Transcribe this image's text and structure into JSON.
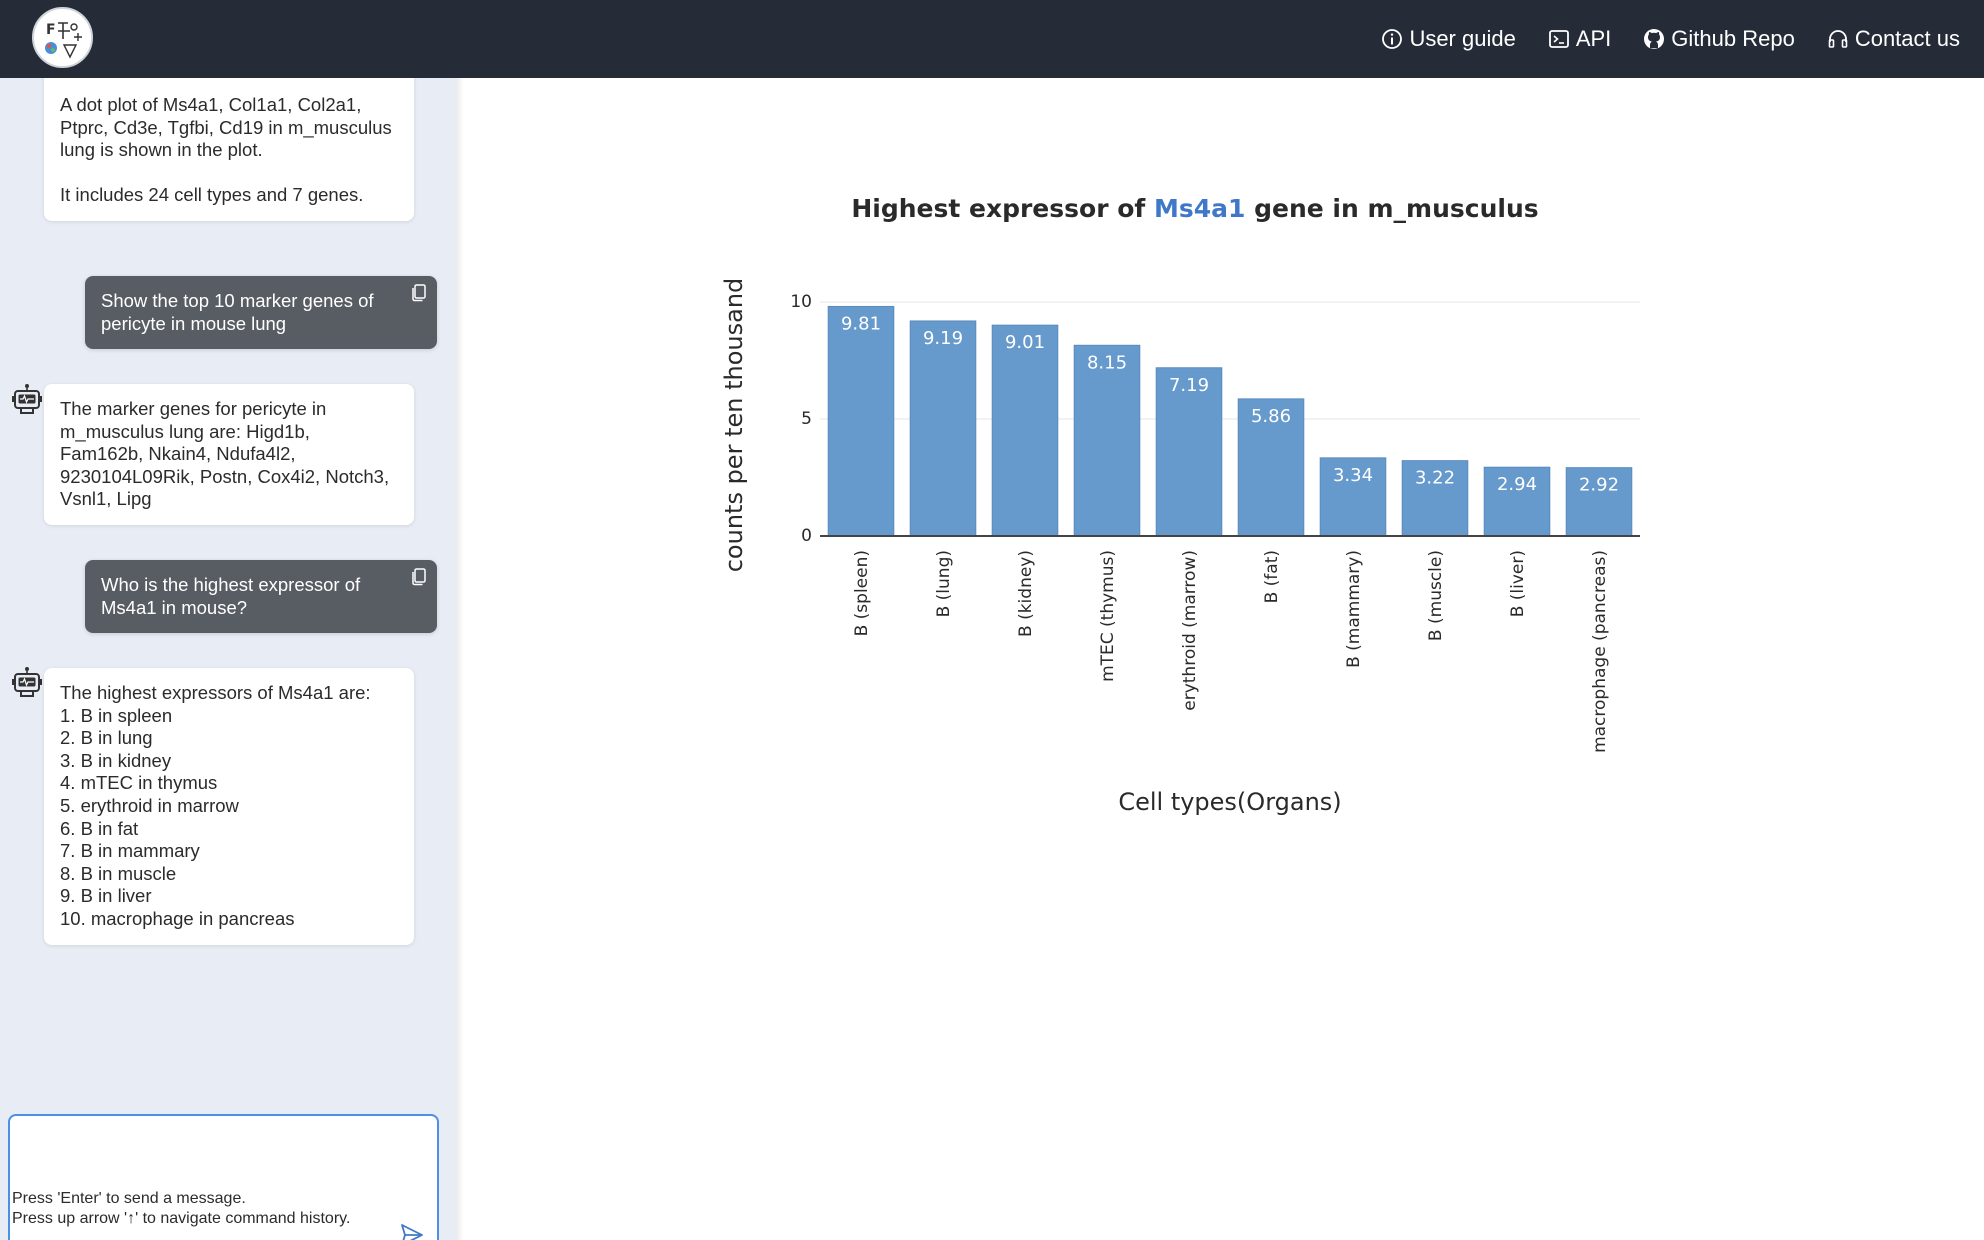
{
  "nav": {
    "items": [
      {
        "label": "User guide",
        "icon": "info-circle-icon"
      },
      {
        "label": "API",
        "icon": "terminal-icon"
      },
      {
        "label": "Github Repo",
        "icon": "github-icon"
      },
      {
        "label": "Contact us",
        "icon": "headphones-icon"
      }
    ]
  },
  "chat": {
    "msg1": "A dot plot of Ms4a1, Col1a1, Col2a1, Ptprc, Cd3e, Tgfbi, Cd19 in m_musculus lung is shown in the plot.\n\nIt includes 24 cell types and 7 genes.",
    "user1": "Show the top 10 marker genes of pericyte in mouse lung",
    "msg2": "The marker genes for pericyte in m_musculus lung are: Higd1b, Fam162b, Nkain4, Ndufa4l2, 9230104L09Rik, Postn, Cox4i2, Notch3, Vsnl1, Lipg",
    "user2": "Who is the highest expressor of Ms4a1 in mouse?",
    "msg3": "The highest expressors of Ms4a1 are:\n1. B in spleen\n2. B in lung\n3. B in kidney\n4. mTEC in thymus\n5. erythroid in marrow\n6. B in fat\n7. B in mammary\n8. B in muscle\n9. B in liver\n10. macrophage in pancreas",
    "input_value": "",
    "hint1": "Press 'Enter' to send a message.",
    "hint2": "Press up arrow '↑' to navigate command history."
  },
  "colors": {
    "topbar": "#252c37",
    "bar": "#6699cc",
    "accent": "#3f78c8",
    "sidebar": "#e8edf5"
  },
  "chart_data": {
    "type": "bar",
    "title_prefix": "Highest expressor of ",
    "title_gene": "Ms4a1",
    "title_suffix": " gene in m_musculus",
    "xlabel": "Cell types(Organs)",
    "ylabel": "counts per ten thousand",
    "ylim": [
      0,
      10
    ],
    "yticks": [
      0,
      5,
      10
    ],
    "grid": true,
    "categories": [
      "B (spleen)",
      "B (lung)",
      "B (kidney)",
      "mTEC (thymus)",
      "erythroid (marrow)",
      "B (fat)",
      "B (mammary)",
      "B (muscle)",
      "B (liver)",
      "macrophage (pancreas)"
    ],
    "values": [
      9.81,
      9.19,
      9.01,
      8.15,
      7.19,
      5.86,
      3.34,
      3.22,
      2.94,
      2.92
    ],
    "labels": [
      "9.81",
      "9.19",
      "9.01",
      "8.15",
      "7.19",
      "5.86",
      "3.34",
      "3.22",
      "2.94",
      "2.92"
    ]
  }
}
